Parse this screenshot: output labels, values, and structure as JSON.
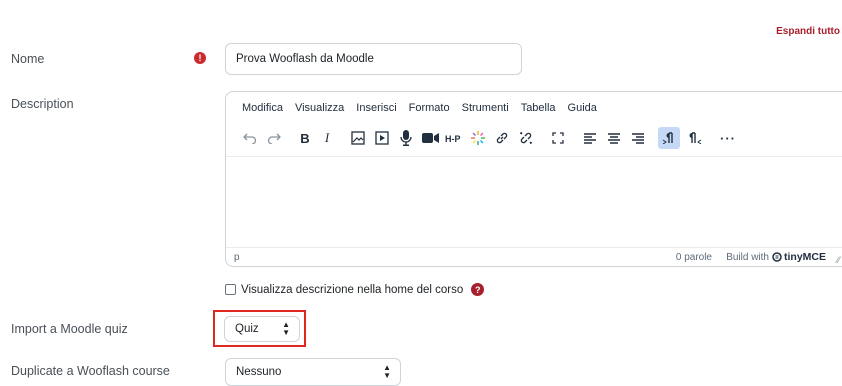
{
  "header": {
    "expand_all": "Espandi tutto"
  },
  "form": {
    "name": {
      "label": "Nome",
      "required_glyph": "!",
      "value": "Prova Wooflash da Moodle"
    },
    "description": {
      "label": "Description",
      "menus": [
        "Modifica",
        "Visualizza",
        "Inserisci",
        "Formato",
        "Strumenti",
        "Tabella",
        "Guida"
      ],
      "toolbar_icons": [
        "undo-icon",
        "redo-icon",
        "bold-icon",
        "italic-icon",
        "image-icon",
        "media-icon",
        "microphone-icon",
        "video-camera-icon",
        "h5p-icon",
        "sparkle-icon",
        "link-icon",
        "unlink-icon",
        "fullscreen-icon",
        "align-left-icon",
        "align-center-icon",
        "align-right-icon",
        "ltr-icon",
        "rtl-icon",
        "more-icon"
      ],
      "statusbar": {
        "path": "p",
        "word_count": "0 parole",
        "build_with": "Build with",
        "brand": "tinyMCE"
      }
    },
    "show_description": {
      "label": "Visualizza descrizione nella home del corso",
      "help_glyph": "?"
    },
    "import_quiz": {
      "label": "Import a Moodle quiz",
      "selected": "Quiz"
    },
    "duplicate_course": {
      "label": "Duplicate a Wooflash course",
      "selected": "Nessuno"
    }
  },
  "colors": {
    "accent": "#a81f2d",
    "required": "#c92b30",
    "highlight": "#e0281e",
    "toolbar_active": "#c5d9f7"
  }
}
